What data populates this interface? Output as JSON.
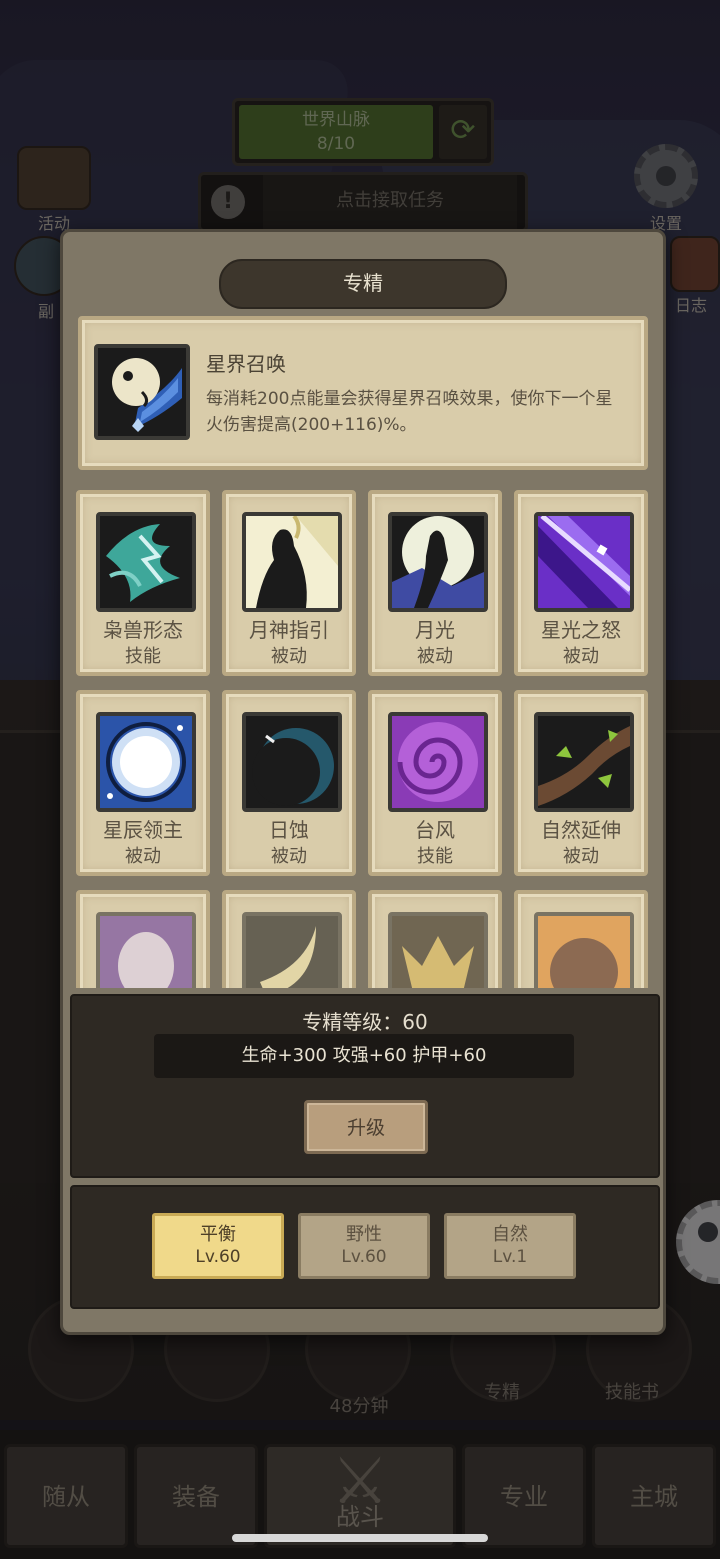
{
  "background": {
    "quest_title": "世界山脉",
    "quest_progress": "8/10",
    "task_prompt": "点击接取任务",
    "left_icons": [
      "活动",
      "副"
    ],
    "right_icons": [
      "设置",
      "日志"
    ],
    "timer": "48分钟",
    "shortcut_labels": [
      "专精",
      "技能书"
    ],
    "bottom_tabs": [
      "随从",
      "装备",
      "战斗",
      "专业",
      "主城"
    ]
  },
  "dialog": {
    "title": "专精",
    "selected": {
      "name": "星界召唤",
      "description": "每消耗200点能量会获得星界召唤效果，使你下一个星火伤害提高(200+116)%。"
    },
    "skills": [
      {
        "name": "枭兽形态",
        "type": "技能",
        "icon": "owlkin-form-icon"
      },
      {
        "name": "月神指引",
        "type": "被动",
        "icon": "moon-goddess-guidance-icon"
      },
      {
        "name": "月光",
        "type": "被动",
        "icon": "moonlight-icon"
      },
      {
        "name": "星光之怒",
        "type": "被动",
        "icon": "starlight-wrath-icon"
      },
      {
        "name": "星辰领主",
        "type": "被动",
        "icon": "star-lord-icon"
      },
      {
        "name": "日蚀",
        "type": "被动",
        "icon": "eclipse-icon"
      },
      {
        "name": "台风",
        "type": "技能",
        "icon": "typhoon-icon"
      },
      {
        "name": "自然延伸",
        "type": "被动",
        "icon": "nature-extension-icon"
      },
      {
        "name": "",
        "type": "",
        "icon": "mask-icon"
      },
      {
        "name": "",
        "type": "",
        "icon": "crescent-blade-icon"
      },
      {
        "name": "",
        "type": "",
        "icon": "flame-beast-icon"
      },
      {
        "name": "",
        "type": "",
        "icon": "sun-orb-icon"
      }
    ],
    "level_label": "专精等级：60",
    "stats": "生命+300  攻强+60  护甲+60",
    "upgrade_label": "升级",
    "specs": [
      {
        "name": "平衡",
        "level": "Lv.60",
        "active": true
      },
      {
        "name": "野性",
        "level": "Lv.60",
        "active": false
      },
      {
        "name": "自然",
        "level": "Lv.1",
        "active": false
      }
    ]
  }
}
